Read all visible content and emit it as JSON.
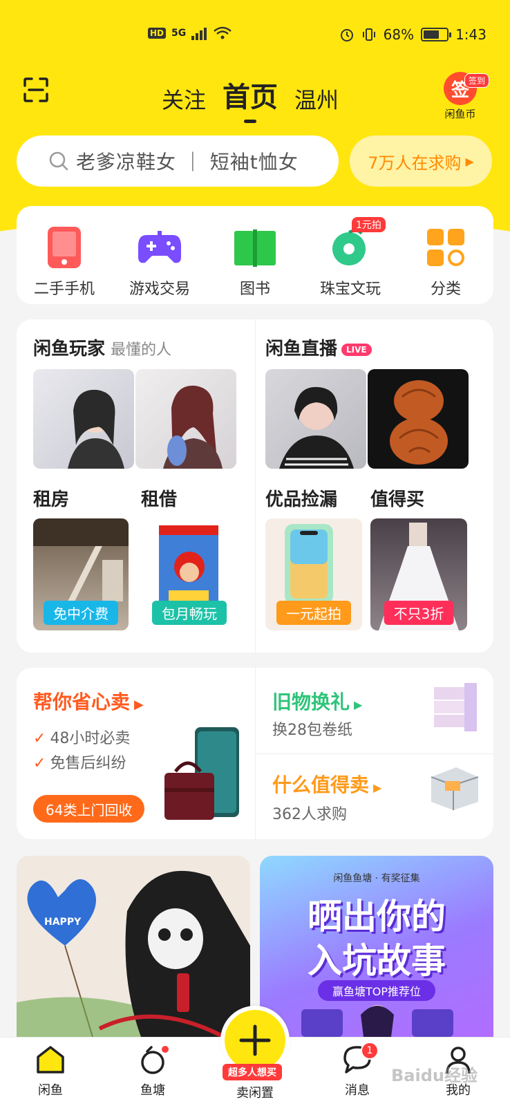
{
  "status_bar": {
    "hd": "HD",
    "signal": "5G",
    "battery": "68%",
    "battery_level": 0.68,
    "time": "1:43"
  },
  "header": {
    "tabs": [
      {
        "label": "关注"
      },
      {
        "label": "首页"
      },
      {
        "label": "温州"
      }
    ],
    "coin_badge": "签到",
    "coin_icon_text": "签",
    "coin_label": "闲鱼币"
  },
  "search": {
    "placeholder": "老爹凉鞋女 ｜ 短袖t恤女",
    "want_button": "7万人在求购"
  },
  "categories": [
    {
      "label": "二手手机",
      "icon": "phone-icon"
    },
    {
      "label": "游戏交易",
      "icon": "gamepad-icon"
    },
    {
      "label": "图书",
      "icon": "book-icon"
    },
    {
      "label": "珠宝文玩",
      "icon": "jewelry-icon",
      "tag": "1元拍"
    },
    {
      "label": "分类",
      "icon": "grid-icon"
    }
  ],
  "features": {
    "players": {
      "title": "闲鱼玩家",
      "subtitle": "最懂的人"
    },
    "live": {
      "title": "闲鱼直播",
      "badge": "LIVE"
    },
    "rent": {
      "title": "租房",
      "pill": "免中介费"
    },
    "borrow": {
      "title": "租借",
      "pill": "包月畅玩"
    },
    "deals": {
      "title": "优品捡漏",
      "pill": "一元起拍"
    },
    "worth": {
      "title": "值得买",
      "pill": "不只3折"
    }
  },
  "services": {
    "sell": {
      "title": "帮你省心卖",
      "points": [
        "48小时必卖",
        "免售后纠纷"
      ],
      "button": "64类上门回收"
    },
    "exchange": {
      "title": "旧物换礼",
      "subtitle": "换28包卷纸"
    },
    "worth_sell": {
      "title": "什么值得卖",
      "subtitle": "362人求购"
    }
  },
  "feed": {
    "banner": {
      "top": "闲鱼鱼塘 · 有奖征集",
      "line1": "晒出你的",
      "line2": "入坑故事",
      "tag": "赢鱼塘TOP推荐位"
    },
    "heart_text": "HAPPY"
  },
  "nav": {
    "home": "闲鱼",
    "pond": "鱼塘",
    "sell": "卖闲置",
    "sell_tag": "超多人想买",
    "messages": "消息",
    "messages_badge": "1",
    "me": "我的"
  },
  "watermark": "Baidu经验"
}
